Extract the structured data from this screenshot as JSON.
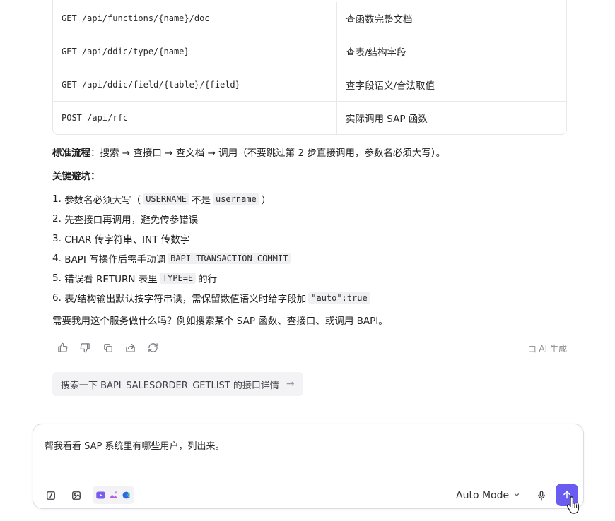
{
  "api_table": {
    "rows": [
      {
        "endpoint": "GET /api/functions/{name}/doc",
        "desc": "查函数完整文档"
      },
      {
        "endpoint": "GET /api/ddic/type/{name}",
        "desc": "查表/结构字段"
      },
      {
        "endpoint": "GET /api/ddic/field/{table}/{field}",
        "desc": "查字段语义/合法取值"
      },
      {
        "endpoint": "POST /api/rfc",
        "desc": "实际调用 SAP 函数"
      }
    ]
  },
  "flow": {
    "label": "标准流程",
    "colon": "：",
    "text": "搜索 → 查接口 → 查文档 → 调用（不要跳过第 2 步直接调用，参数名必须大写）。"
  },
  "pitfalls": {
    "heading": "关键避坑",
    "colon": "：",
    "items": [
      {
        "num": "1.",
        "pre": "参数名必须大写（",
        "code1": "USERNAME",
        "mid": "不是",
        "code2": "username",
        "post": "）"
      },
      {
        "num": "2.",
        "text": "先查接口再调用，避免传参错误"
      },
      {
        "num": "3.",
        "text": "CHAR 传字符串、INT 传数字"
      },
      {
        "num": "4.",
        "pre": "BAPI 写操作后需手动调",
        "code": "BAPI_TRANSACTION_COMMIT",
        "post": ""
      },
      {
        "num": "5.",
        "pre": "错误看 RETURN 表里",
        "code": "TYPE=E",
        "post": "的行"
      },
      {
        "num": "6.",
        "pre": "表/结构输出默认按字符串读，需保留数值语义时给字段加",
        "code": "\"auto\":true",
        "post": ""
      }
    ]
  },
  "closing": "需要我用这个服务做什么吗？例如搜索某个 SAP 函数、查接口、或调用 BAPI。",
  "ai_label": "由 AI 生成",
  "actions": [
    "thumbs-up-icon",
    "thumbs-down-icon",
    "copy-icon",
    "share-icon",
    "refresh-icon"
  ],
  "suggestion": {
    "text": "搜索一下 BAPI_SALESORDER_GETLIST 的接口详情",
    "arrow": "→"
  },
  "composer": {
    "input_value": "帮我看看 SAP 系统里有哪些用户，列出来。",
    "mode_label": "Auto Mode",
    "plugin_colors": [
      "#7c5cf0",
      "#b25be0",
      "#2f6be0"
    ],
    "send_color": "#6a5cf0"
  }
}
